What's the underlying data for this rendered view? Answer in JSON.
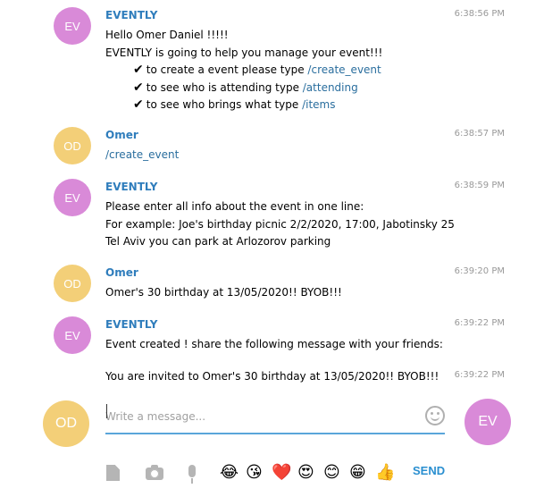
{
  "colors": {
    "ev_avatar": "#d98ad8",
    "od_avatar": "#f3cf78",
    "name": "#2f7dbc",
    "link": "#2a6e9e",
    "accent": "#5aa6da",
    "send": "#2a8fd0"
  },
  "messages": [
    {
      "avatar": "EV",
      "sender": "EVENTLY",
      "time": "6:38:56 PM",
      "lines": [
        "Hello Omer Daniel !!!!!",
        "EVENTLY is going to help you manage your event!!!"
      ],
      "checks": [
        {
          "text": "to create a event please type ",
          "cmd": "/create_event"
        },
        {
          "text": "to see who is attending type ",
          "cmd": "/attending"
        },
        {
          "text": "to see who brings what type ",
          "cmd": "/items"
        }
      ]
    },
    {
      "avatar": "OD",
      "sender": "Omer",
      "time": "6:38:57 PM",
      "cmd": "/create_event"
    },
    {
      "avatar": "EV",
      "sender": "EVENTLY",
      "time": "6:38:59 PM",
      "lines": [
        "Please enter all info about the event in one line:",
        "For example: Joe's birthday picnic 2/2/2020, 17:00, Jabotinsky 25",
        "Tel Aviv you can park at Arlozorov parking"
      ]
    },
    {
      "avatar": "OD",
      "sender": "Omer",
      "time": "6:39:20 PM",
      "lines": [
        "Omer's 30 birthday at 13/05/2020!! BYOB!!!"
      ]
    },
    {
      "avatar": "EV",
      "sender": "EVENTLY",
      "time": "6:39:22 PM",
      "lines": [
        "Event created ! share the following message with your friends:"
      ]
    },
    {
      "time": "6:39:22 PM",
      "lines": [
        "You are invited to Omer's 30 birthday at 13/05/2020!! BYOB!!!"
      ]
    }
  ],
  "composer": {
    "placeholder": "Write a message...",
    "user_avatar": "OD",
    "bot_avatar": "EV",
    "send_label": "SEND",
    "check_mark": "✔",
    "emojis": [
      "😂",
      "😘",
      "❤️",
      "😍",
      "😊",
      "😁",
      "👍"
    ]
  }
}
